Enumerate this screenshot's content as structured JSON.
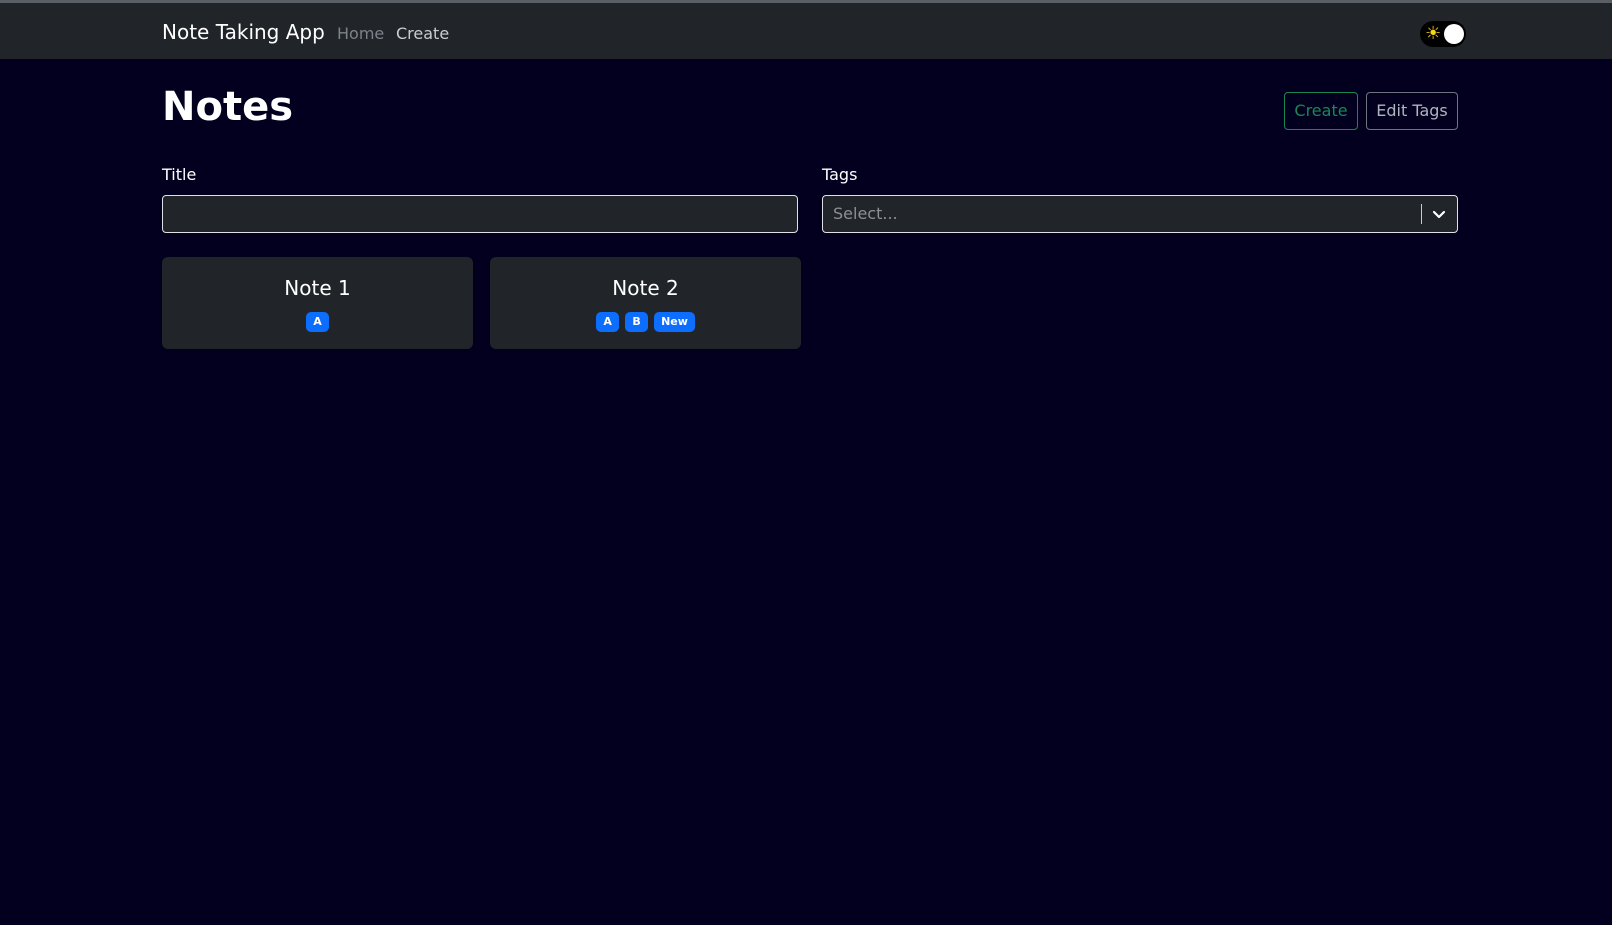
{
  "navbar": {
    "brand": "Note Taking App",
    "links": [
      {
        "label": "Home"
      },
      {
        "label": "Create"
      }
    ],
    "theme_toggle": {
      "icon": "sun-icon",
      "glyph": "☀"
    }
  },
  "page": {
    "title": "Notes",
    "actions": {
      "create_label": "Create",
      "edit_tags_label": "Edit Tags"
    }
  },
  "filters": {
    "title_label": "Title",
    "title_value": "",
    "tags_label": "Tags",
    "tags_placeholder": "Select..."
  },
  "notes": [
    {
      "title": "Note 1",
      "tags": [
        "A"
      ]
    },
    {
      "title": "Note 2",
      "tags": [
        "A",
        "B",
        "New"
      ]
    }
  ],
  "colors": {
    "background": "#03001f",
    "navbar": "#212529",
    "success": "#198754",
    "secondary": "#6c757d",
    "badge": "#0d6efd"
  }
}
